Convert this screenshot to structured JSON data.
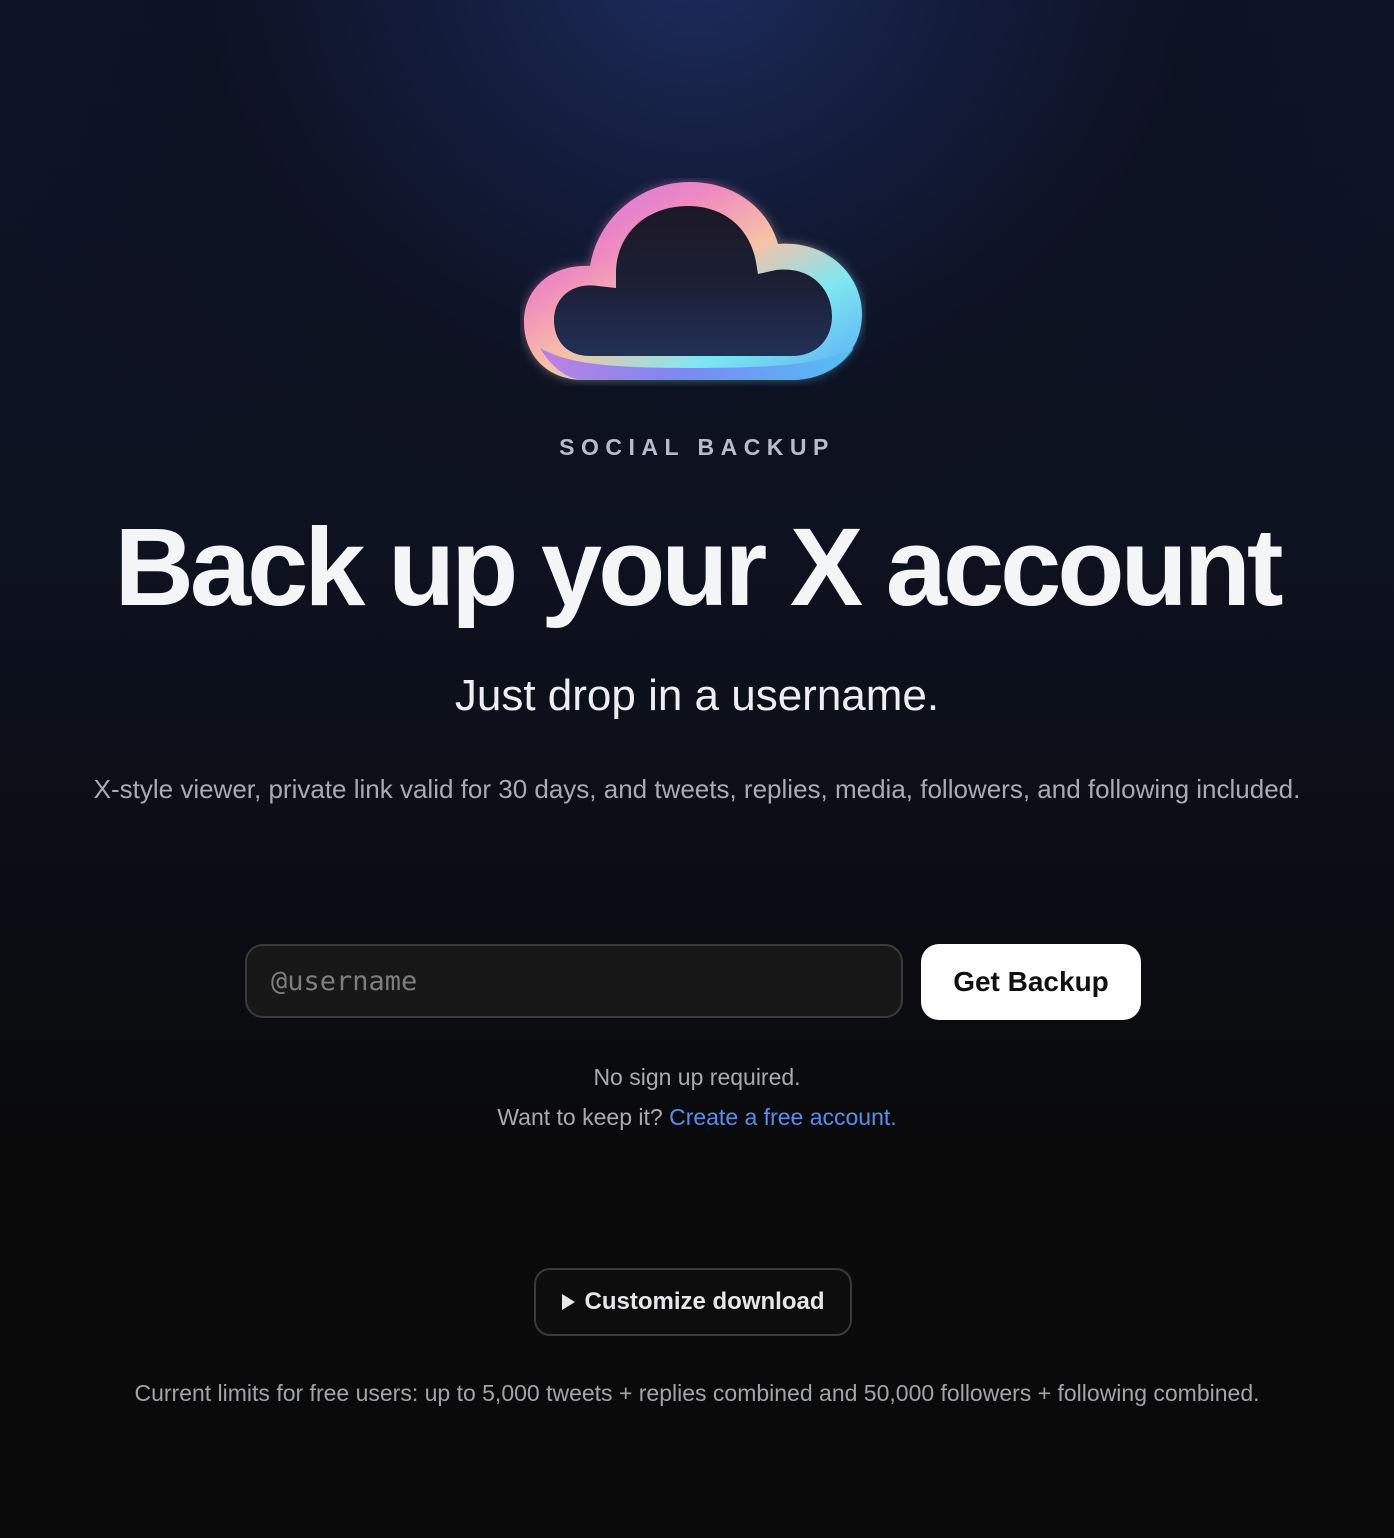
{
  "brand": {
    "label": "SOCIAL BACKUP",
    "logo_icon": "cloud-icon"
  },
  "hero": {
    "headline": "Back up your X account",
    "subheadline": "Just drop in a username.",
    "description": "X-style viewer, private link valid for 30 days, and tweets, replies, media, followers, and following included."
  },
  "form": {
    "username_placeholder": "@username",
    "username_value": "",
    "submit_label": "Get Backup"
  },
  "notes": {
    "no_signup": "No sign up required.",
    "keep_prefix": "Want to keep it?",
    "create_account_link": "Create a free account."
  },
  "customize": {
    "label": "Customize download",
    "icon": "play-triangle-icon"
  },
  "footer": {
    "limits": "Current limits for free users: up to 5,000 tweets + replies combined and 50,000 followers + following combined."
  },
  "colors": {
    "background_dark": "#0a0a0a",
    "background_navy": "#0e1428",
    "link_blue": "#5b8def",
    "button_white": "#ffffff",
    "gradient_pink": "#f08ac0",
    "gradient_peach": "#f8c8a8",
    "gradient_violet": "#8b5cf6",
    "gradient_cyan": "#67e8f9"
  }
}
